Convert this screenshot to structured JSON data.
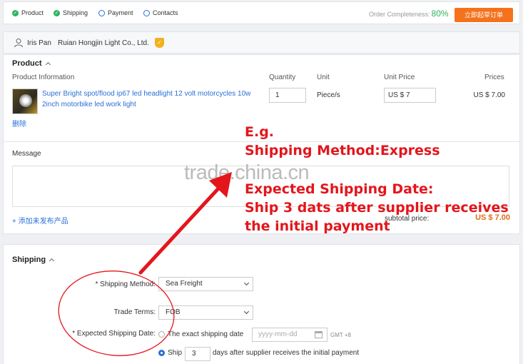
{
  "steps": [
    {
      "label": "Product",
      "done": true
    },
    {
      "label": "Shipping",
      "done": true
    },
    {
      "label": "Payment",
      "done": false
    },
    {
      "label": "Contacts",
      "done": false
    }
  ],
  "completeness": {
    "label": "Order Completeness:",
    "value": "80%"
  },
  "order_button": "立即起草订单",
  "supplier": {
    "name": "Iris Pan",
    "company": "Ruian Hongjin Light Co., Ltd.",
    "badge": "✓"
  },
  "product": {
    "section_title": "Product",
    "columns": [
      "Product Information",
      "Quantity",
      "Unit",
      "Unit Price",
      "Prices"
    ],
    "item": {
      "name": "Super Bright spot/flood ip67 led headlight 12 volt motorcycles 10w 2inch motorbike led work light",
      "quantity": "1",
      "unit": "Piece/s",
      "unit_price": "US $ 7",
      "price": "US $ 7.00"
    },
    "delete_label": "删除",
    "message_label": "Message",
    "add_link": "添加未发布产品",
    "subtotal_label": "subtotal price:",
    "subtotal_value": "US $ 7.00"
  },
  "watermark": "trade.china.cn",
  "annotation": [
    "E.g.",
    "Shipping Method:Express",
    "Expected Shipping Date:",
    "Ship 3 dats after supplier receives",
    "the initial payment"
  ],
  "shipping": {
    "section_title": "Shipping",
    "method_label": "* Shipping Method:",
    "method_value": "Sea Freight",
    "terms_label": "Trade Terms:",
    "terms_value": "FOB",
    "date_label": "* Expected Shipping Date:",
    "exact_label": "The exact shipping date",
    "date_placeholder": "yyyy-mm-dd",
    "gmt": "GMT +8",
    "ship_label": "Ship",
    "ship_days": "3",
    "ship_suffix": "days after supplier receives the initial payment"
  },
  "colors": {
    "accent": "#f5721c",
    "link": "#2a6fd6",
    "annotation": "#e3161c",
    "success": "#2db55d"
  }
}
